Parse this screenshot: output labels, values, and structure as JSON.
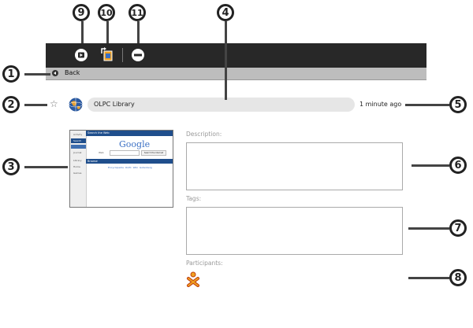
{
  "toolbar": {
    "back_label": "Back",
    "icons": [
      "resume-icon",
      "copy-to-icon",
      "remove-icon"
    ]
  },
  "entry": {
    "title": "OLPC Library",
    "timestamp": "1 minute ago"
  },
  "fields": {
    "description_label": "Description:",
    "tags_label": "Tags:",
    "participants_label": "Participants:"
  },
  "thumbnail": {
    "header": "Search the Web",
    "brand": "Google",
    "search_label": "Web",
    "button_label": "Search the Internet",
    "section": "Browse",
    "links": "Encyclopedia  OLPC  Wiki  Gutenberg",
    "sidebar_items": [
      "Activity",
      "Search",
      "Journal",
      "Library",
      "Home",
      "Games",
      "Maps"
    ]
  },
  "callouts": [
    "1",
    "2",
    "3",
    "4",
    "5",
    "6",
    "7",
    "8",
    "9",
    "10",
    "11"
  ],
  "colors": {
    "toolbar": "#282828",
    "backbar": "#bdbdbd",
    "accent": "#1f4e8c"
  }
}
